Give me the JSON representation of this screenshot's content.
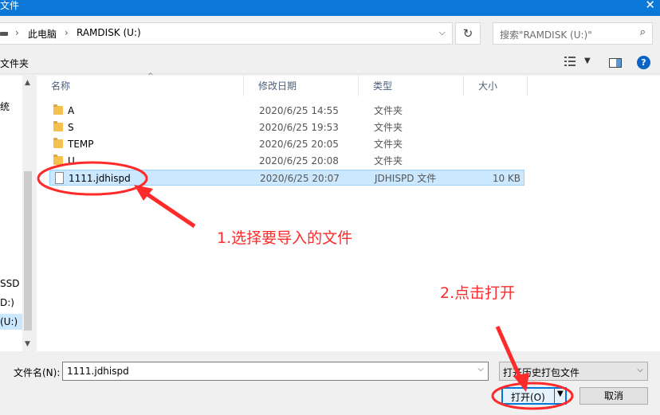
{
  "window": {
    "title": "文件",
    "close_glyph": "✕"
  },
  "address": {
    "sep1": "›",
    "crumb1": "此电脑",
    "sep2": "›",
    "crumb2": "RAMDISK (U:)",
    "dropdown": "⌵",
    "refresh": "↻"
  },
  "search": {
    "placeholder": "搜索\"RAMDISK (U:)\"",
    "icon": "⌕"
  },
  "toolbar": {
    "new_folder": "文件夹",
    "view_drop": "▼",
    "help": "?"
  },
  "nav": {
    "items": [
      {
        "label": "统"
      },
      {
        "label": "SSD"
      },
      {
        "label": "D:)"
      },
      {
        "label": "(U:)"
      }
    ],
    "up": "▲",
    "down": "▼"
  },
  "columns": {
    "name": "名称",
    "date": "修改日期",
    "type": "类型",
    "size": "大小",
    "sort_glyph": "^"
  },
  "files": [
    {
      "name": "A",
      "date": "2020/6/25 14:55",
      "type": "文件夹",
      "size": ""
    },
    {
      "name": "S",
      "date": "2020/6/25 19:53",
      "type": "文件夹",
      "size": ""
    },
    {
      "name": "TEMP",
      "date": "2020/6/25 20:05",
      "type": "文件夹",
      "size": ""
    },
    {
      "name": "U",
      "date": "2020/6/25 20:08",
      "type": "文件夹",
      "size": ""
    },
    {
      "name": "1111.jdhispd",
      "date": "2020/6/25 20:07",
      "type": "JDHISPD 文件",
      "size": "10 KB"
    }
  ],
  "bottom": {
    "filename_label": "文件名(N):",
    "filename_value": "1111.jdhispd",
    "filter_value": "打开历史打包文件",
    "drop": "⌵",
    "open_label": "打开(O)",
    "open_arrow": "▼",
    "cancel_label": "取消"
  },
  "annotations": {
    "step1": "1.选择要导入的文件",
    "step2": "2.点击打开"
  },
  "colors": {
    "accent": "#0b78d7",
    "selection": "#cce8ff",
    "annotation": "#ff2a2a"
  }
}
